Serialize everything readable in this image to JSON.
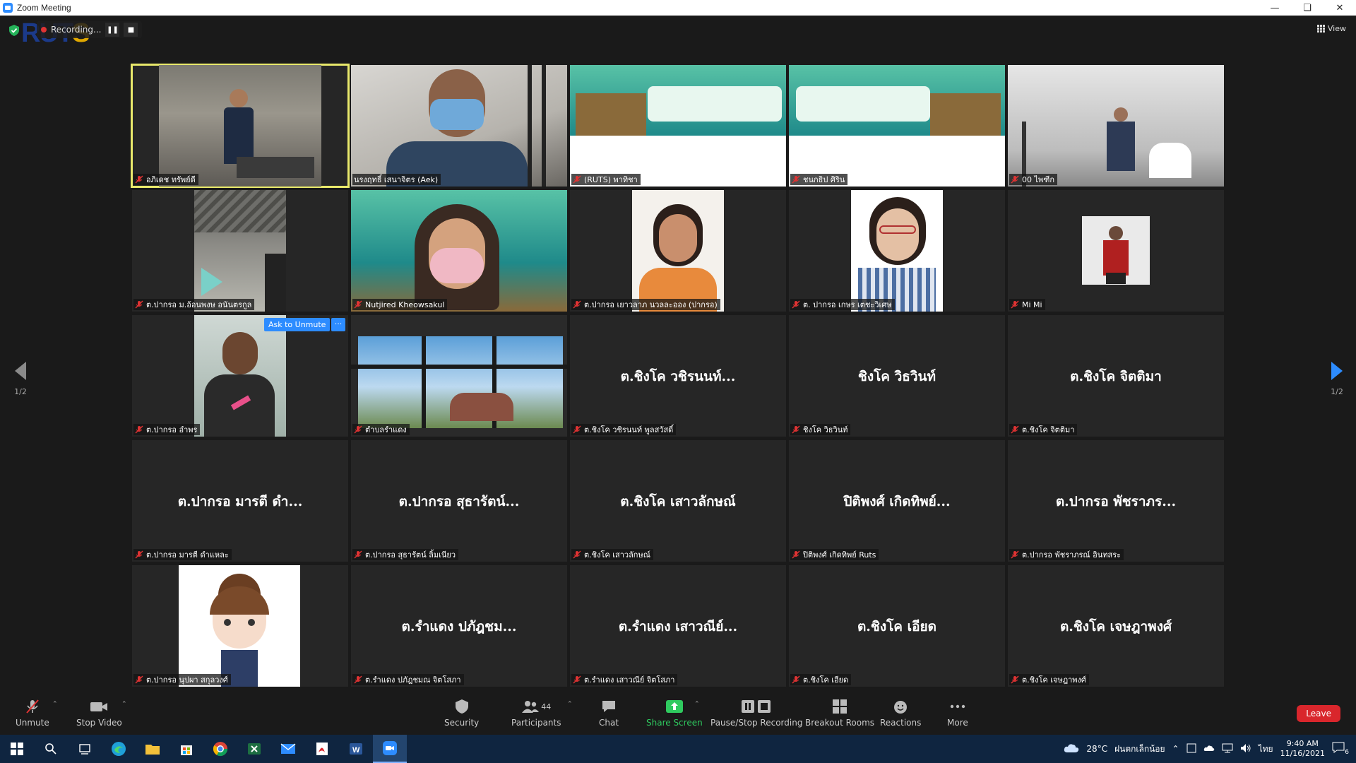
{
  "window": {
    "title": "Zoom Meeting"
  },
  "recording": {
    "label": "Recording..."
  },
  "view": {
    "label": "View"
  },
  "pagination": {
    "left": "1/2",
    "right": "1/2"
  },
  "tiles": [
    {
      "label": "อภิเดช ทรัพย์ดี",
      "type": "video",
      "active": true
    },
    {
      "label": "นรงฤทธิ์ เสนาจิตร (Aek)",
      "type": "video"
    },
    {
      "label": "(RUTS) พาทิชา",
      "type": "video"
    },
    {
      "label": "ชนกธิป ศิริน",
      "type": "video"
    },
    {
      "label": "00 ไพฑีก",
      "type": "video"
    },
    {
      "label": "ต.ปากรอ ม.อ้อนพงษ อนันตรกูล",
      "type": "video"
    },
    {
      "label": "Nutjired Kheowsakul",
      "type": "video"
    },
    {
      "label": "ต.ปากรอ เยาวลาภ นวลละออง (ปากรอ)",
      "type": "video"
    },
    {
      "label": "ต. ปากรอ เกษร เตชะวิเศษ",
      "type": "video"
    },
    {
      "label": "Mi Mi",
      "type": "video"
    },
    {
      "label": "ต.ปากรอ อำพร",
      "type": "video",
      "ask_unmute": "Ask to Unmute",
      "more": "···"
    },
    {
      "label": "ตำบลรำแดง",
      "type": "video"
    },
    {
      "label": "ต.ชิงโค วชิรนนท์ พูลสวัสดิ์",
      "name": "ต.ชิงโค วชิรนนท์...",
      "type": "name"
    },
    {
      "label": "ชิงโค วิธวินท์",
      "name": "ชิงโค วิธวินท์",
      "type": "name"
    },
    {
      "label": "ต.ชิงโค จิตติมา",
      "name": "ต.ชิงโค จิตติมา",
      "type": "name"
    },
    {
      "label": "ต.ปากรอ มารตี ดำแหละ",
      "name": "ต.ปากรอ มารตี ดำ...",
      "type": "name"
    },
    {
      "label": "ต.ปากรอ สุธารัตน์ ลิ้มเนียว",
      "name": "ต.ปากรอ สุธารัตน์...",
      "type": "name"
    },
    {
      "label": "ต.ชิงโค เสาวลักษณ์",
      "name": "ต.ชิงโค เสาวลักษณ์",
      "type": "name"
    },
    {
      "label": "ปิติพงศ์ เกิดทิพย์ Ruts",
      "name": "ปิติพงศ์ เกิดทิพย์...",
      "type": "name"
    },
    {
      "label": "ต.ปากรอ พัชราภรณ์ อินทสระ",
      "name": "ต.ปากรอ พัชราภร...",
      "type": "name"
    },
    {
      "label": "ต.ปากรอ นุปผา สกุลวงศ์",
      "type": "video"
    },
    {
      "label": "ต.รำแดง ปภัฎชมณ จิตโสภา",
      "name": "ต.รำแดง ปภัฎชม...",
      "type": "name"
    },
    {
      "label": "ต.รำแดง เสาวณีย์ จิตโสภา",
      "name": "ต.รำแดง เสาวณีย์...",
      "type": "name"
    },
    {
      "label": "ต.ชิงโค เอียด",
      "name": "ต.ชิงโค เอียด",
      "type": "name"
    },
    {
      "label": "ต.ชิงโค เจษฎาพงศ์",
      "name": "ต.ชิงโค เจษฎาพงศ์",
      "type": "name"
    }
  ],
  "toolbar": {
    "unmute": "Unmute",
    "stop_video": "Stop Video",
    "security": "Security",
    "participants": "Participants",
    "participants_count": "44",
    "chat": "Chat",
    "share_screen": "Share Screen",
    "pause_stop_recording": "Pause/Stop Recording",
    "breakout_rooms": "Breakout Rooms",
    "reactions": "Reactions",
    "more": "More",
    "leave": "Leave"
  },
  "taskbar": {
    "weather": "28°C",
    "weather_desc": "ฝนตกเล็กน้อย",
    "lang": "ไทย",
    "time": "9:40 AM",
    "date": "11/16/2021",
    "notif_count": "6"
  },
  "colors": {
    "accent": "#2d8cff",
    "leave": "#d9262c",
    "active_border": "#e9e96b",
    "share_green": "#2fca5f",
    "mute_red": "#e03333"
  }
}
